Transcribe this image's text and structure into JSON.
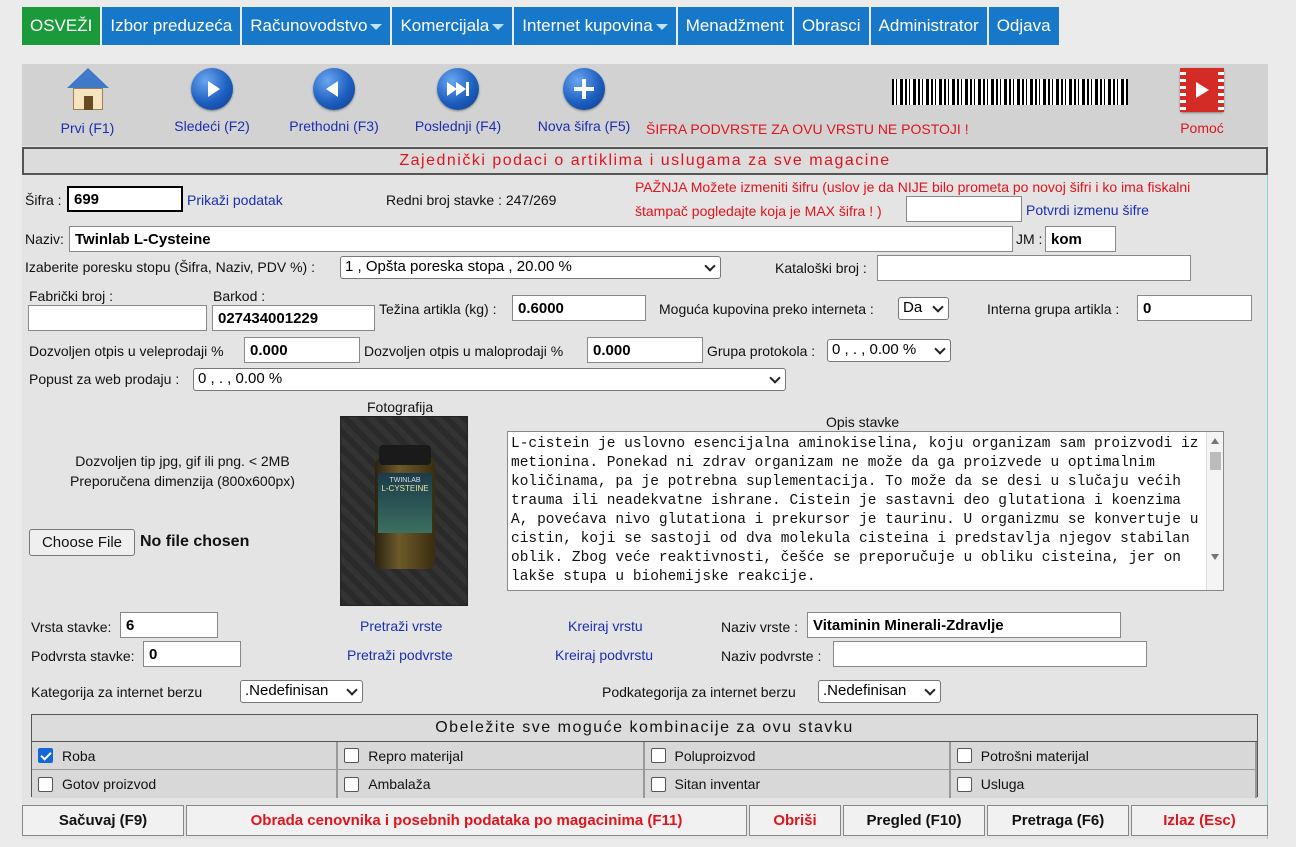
{
  "menu": [
    {
      "label": "OSVEŽI",
      "active": true,
      "dropdown": false
    },
    {
      "label": "Izbor preduzeća",
      "dropdown": false
    },
    {
      "label": "Računovodstvo",
      "dropdown": true
    },
    {
      "label": "Komercijala",
      "dropdown": true
    },
    {
      "label": "Internet kupovina",
      "dropdown": true
    },
    {
      "label": "Menadžment",
      "dropdown": false
    },
    {
      "label": "Obrasci",
      "dropdown": false
    },
    {
      "label": "Administrator",
      "dropdown": false
    },
    {
      "label": "Odjava",
      "dropdown": false
    }
  ],
  "toolbar": {
    "first": "Prvi (F1)",
    "next": "Sledeći (F2)",
    "prev": "Prethodni (F3)",
    "last": "Poslednji (F4)",
    "new": "Nova šifra (F5)",
    "warning": "ŠIFRA PODVRSTE ZA OVU VRSTU NE POSTOJI !",
    "help": "Pomoć"
  },
  "section_title": "Zajednički podaci o artiklima i uslugama za sve magacine",
  "form": {
    "sifra_label": "Šifra :",
    "sifra_value": "699",
    "show_data": "Prikaži podatak",
    "row_index": "Redni broj stavke : 247/269",
    "change_warning_1": "PAŽNJA Možete izmeniti šifru (uslov je da NIJE bilo prometa po novoj šifri i ko ima fiskalni",
    "change_warning_2": "štampač pogledajte koja je MAX šifra ! )",
    "confirm_change": "Potvrdi izmenu šifre",
    "new_code_value": "",
    "naziv_label": "Naziv:",
    "naziv_value": "Twinlab L-Cysteine",
    "jm_label": "JM :",
    "jm_value": "kom",
    "tax_label": "Izaberite poresku stopu (Šifra, Naziv, PDV %) :",
    "tax_value": "1 , Opšta poreska stopa , 20.00 %",
    "catalog_label": "Kataloški broj :",
    "catalog_value": "",
    "factory_label": "Fabrički broj :",
    "factory_value": "",
    "barcode_label": "Barkod :",
    "barcode_value": "027434001229",
    "weight_label": "Težina artikla (kg) :",
    "weight_value": "0.6000",
    "internet_label": "Moguća kupovina preko interneta :",
    "internet_value": "Da",
    "group_label": "Interna grupa artikla :",
    "group_value": "0",
    "wholesale_label": "Dozvoljen otpis u veleprodaji %",
    "wholesale_value": "0.000",
    "retail_label": "Dozvoljen otpis u maloprodaji %",
    "retail_value": "0.000",
    "protocol_label": "Grupa protokola :",
    "protocol_value": "0 , . , 0.00 %",
    "web_discount_label": "Popust za web prodaju :",
    "web_discount_value": "0 , . , 0.00 %",
    "photo_label": "Fotografija",
    "photo_brand": "TWINLAB",
    "photo_product": "L-CYSTEINE",
    "file_hint_1": "Dozvoljen tip jpg, gif ili png. < 2MB",
    "file_hint_2": "Preporučena dimenzija (800x600px)",
    "choose_file": "Choose File",
    "no_file": "No file chosen",
    "desc_label": "Opis stavke",
    "desc_value": "L-cistein je uslovno esencijalna aminokiselina, koju organizam sam proizvodi iz metionina. Ponekad ni zdrav organizam ne može da ga proizvede u optimalnim količinama, pa je potrebna suplementacija. To može da se desi u slučaju većih trauma ili neadekvatne ishrane. Cistein je sastavni deo glutationa i koenzima A, povećava nivo glutationa i prekursor je taurinu. U organizmu se konvertuje u cistin, koji se sastoji od dva molekula cisteina i predstavlja njegov stabilan oblik. Zbog veće reaktivnosti, češće se preporučuje u obliku cisteina, jer on lakše stupa u biohemijske reakcije.",
    "type_label": "Vrsta stavke:",
    "type_value": "6",
    "search_types": "Pretraži vrste",
    "create_type": "Kreiraj vrstu",
    "type_name_label": "Naziv vrste :",
    "type_name_value": "Vitaminin Minerali-Zdravlje",
    "subtype_label": "Podvrsta stavke:",
    "subtype_value": "0",
    "search_subtypes": "Pretraži podvrste",
    "create_subtype": "Kreiraj podvrstu",
    "subtype_name_label": "Naziv podvrste :",
    "subtype_name_value": "",
    "category_label": "Kategorija za internet berzu",
    "category_value": ".Nedefinisan",
    "subcategory_label": "Podkategorija za internet berzu",
    "subcategory_value": ".Nedefinisan"
  },
  "combos": {
    "title": "Obeležite sve moguće kombinacije za ovu stavku",
    "items": [
      {
        "label": "Roba",
        "checked": true
      },
      {
        "label": "Repro materijal",
        "checked": false
      },
      {
        "label": "Poluproizvod",
        "checked": false
      },
      {
        "label": "Potrošni materijal",
        "checked": false
      },
      {
        "label": "Gotov proizvod",
        "checked": false
      },
      {
        "label": "Ambalaža",
        "checked": false
      },
      {
        "label": "Sitan inventar",
        "checked": false
      },
      {
        "label": "Usluga",
        "checked": false
      }
    ]
  },
  "buttons": {
    "save": "Sačuvaj (F9)",
    "pricing": "Obrada cenovnika i posebnih podataka po magacinima (F11)",
    "delete": "Obriši",
    "review": "Pregled (F10)",
    "search": "Pretraga (F6)",
    "exit": "Izlaz (Esc)"
  },
  "colors": {
    "menu": "#1777c8",
    "menu_active": "#1a9a3b",
    "link": "#1a2fb0",
    "warning": "#e0141c"
  }
}
